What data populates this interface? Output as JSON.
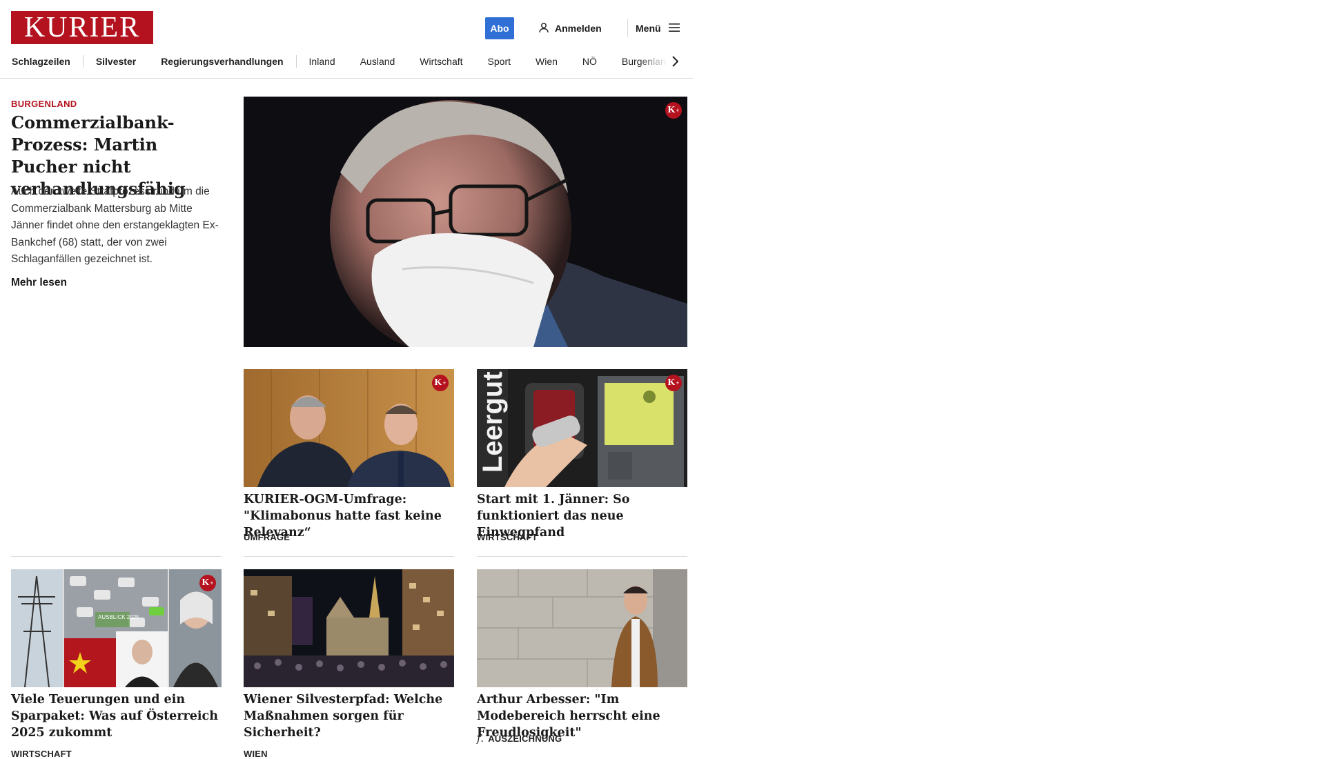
{
  "header": {
    "logo_text": "KURIER",
    "abo_label": "Abo",
    "login_label": "Anmelden",
    "menu_label": "Menü"
  },
  "nav": {
    "items": [
      "Schlagzeilen",
      "Silvester",
      "Regierungsverhandlungen",
      "Inland",
      "Ausland",
      "Wirtschaft",
      "Sport",
      "Wien",
      "NÖ",
      "Burgenland"
    ]
  },
  "lead": {
    "kicker": "BURGENLAND",
    "title": "Commerzialbank-Prozess: Martin Pucher nicht verhandlungsfähig",
    "text": "Auch der zweite Strafprozess rund um die Commerzialbank Mattersburg ab Mitte Jänner findet ohne den erstangeklagten Ex-Bankchef (68) statt, der von zwei Schlaganfällen gezeichnet ist.",
    "more_label": "Mehr lesen",
    "plus": true
  },
  "cards": [
    {
      "title": "KURIER-OGM-Umfrage: \"Klimabonus hatte fast keine Relevanz“",
      "tag": "UMFRAGE",
      "plus": true
    },
    {
      "title": "Start mit 1. Jänner: So funktioniert das neue Einwegpfand",
      "tag": "WIRTSCHAFT",
      "plus": true
    },
    {
      "title": "Viele Teuerungen und ein Sparpaket: Was auf Österreich 2025 zukommt",
      "tag": "WIRTSCHAFT",
      "plus": true,
      "image_overlay_text": "AUSBLICK 2025"
    },
    {
      "title": "Wiener Silvesterpfad: Welche Maßnahmen sorgen für Sicherheit?",
      "tag": "WIEN",
      "plus": false
    },
    {
      "title": "Arthur Arbesser: \"Im Modebereich herrscht eine Freudlosigkeit\"",
      "tag": "AUSZEICHNUNG",
      "tag_icon": "f.",
      "plus": false
    }
  ],
  "colors": {
    "brand": "#b4121f",
    "abo": "#2f6fd6"
  }
}
